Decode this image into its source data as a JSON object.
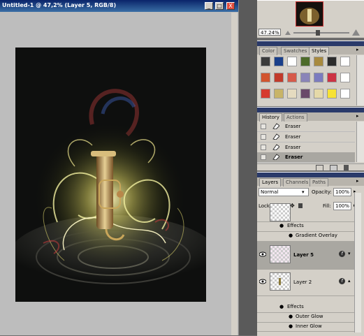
{
  "document": {
    "title": "Untitled-1 @ 47,2% (Layer 5, RGB/8)",
    "buttons": {
      "minimize": "_",
      "maximize": "□",
      "close": "X"
    }
  },
  "navigator": {
    "zoom": "47.24%"
  },
  "styles_panel": {
    "tabs": [
      "Color",
      "Swatches",
      "Styles"
    ],
    "active_tab": "Styles",
    "swatch_colors": [
      "#3b3b3b",
      "#1a3f8a",
      "#ffffff",
      "#4d6b2a",
      "#a88a3e",
      "#2c2c2c",
      "#ffffff",
      "#d2542e",
      "#c23a2a",
      "#d65a4a",
      "#8a84b8",
      "#7b7bbf",
      "#cc3344",
      "#ffffff",
      "#d63a2e",
      "#c8b468",
      "#e5dbc0",
      "#6a4a6a",
      "#e5d9a8",
      "#f7e233",
      "#ffffff"
    ]
  },
  "history_panel": {
    "tabs": [
      "History",
      "Actions"
    ],
    "active_tab": "History",
    "items": [
      "Eraser",
      "Eraser",
      "Eraser",
      "Eraser"
    ],
    "selected_index": 3
  },
  "layers_panel": {
    "tabs": [
      "Layers",
      "Channels",
      "Paths"
    ],
    "active_tab": "Layers",
    "blend_mode": "Normal",
    "opacity_label": "Opacity:",
    "opacity": "100%",
    "lock_label": "Lock:",
    "fill_label": "Fill:",
    "fill": "100%",
    "rows": {
      "effects_a": "Effects",
      "gradient_overlay": "Gradient Overlay",
      "layer5": "Layer 5",
      "layer2": "Layer 2",
      "effects_b": "Effects",
      "outer_glow": "Outer Glow",
      "inner_glow": "Inner Glow"
    }
  }
}
